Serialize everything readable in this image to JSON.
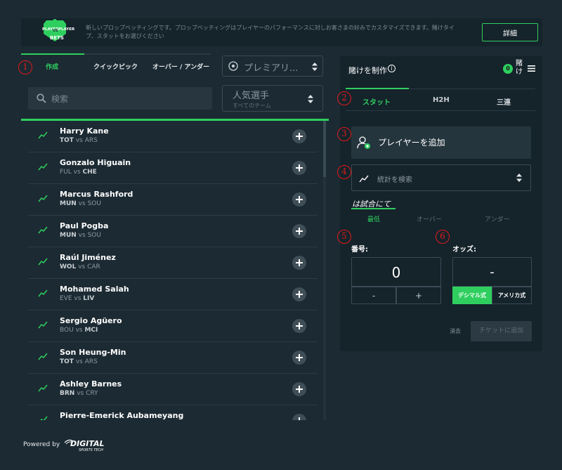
{
  "banner": {
    "description": "新しいプロップベッティングです。プロップベッティングはプレイヤーのパフォーマンスに対しお客さまの好みでカスタマイズできます。賭けタイプ、スタットをお選びください",
    "details_button": "詳細",
    "logo_text_top_left": "PLAYER",
    "logo_text_vs": "VS",
    "logo_text_top_right": "PLAYER",
    "logo_text_bottom": "BETS"
  },
  "left_tabs": [
    "作成",
    "クイックピック",
    "オーバー / アンダー"
  ],
  "league_select": {
    "value": "プレミアリ..."
  },
  "search": {
    "placeholder": "検索"
  },
  "popular_select": {
    "value": "人気選手",
    "sub": "すべてのチーム"
  },
  "players": [
    {
      "name": "Harry Kane",
      "home": "TOT",
      "away": "ARS",
      "bold": "home"
    },
    {
      "name": "Gonzalo Higuain",
      "home": "FUL",
      "away": "CHE",
      "bold": "away"
    },
    {
      "name": "Marcus Rashford",
      "home": "MUN",
      "away": "SOU",
      "bold": "home"
    },
    {
      "name": "Paul Pogba",
      "home": "MUN",
      "away": "SOU",
      "bold": "home"
    },
    {
      "name": "Raúl Jiménez",
      "home": "WOL",
      "away": "CAR",
      "bold": "home"
    },
    {
      "name": "Mohamed Salah",
      "home": "EVE",
      "away": "LIV",
      "bold": "away"
    },
    {
      "name": "Sergio Agüero",
      "home": "BOU",
      "away": "MCI",
      "bold": "away"
    },
    {
      "name": "Son Heung-Min",
      "home": "TOT",
      "away": "ARS",
      "bold": "home"
    },
    {
      "name": "Ashley Barnes",
      "home": "BRN",
      "away": "CRY",
      "bold": "home"
    },
    {
      "name": "Pierre-Emerick Aubameyang",
      "home": "",
      "away": "",
      "bold": ""
    }
  ],
  "vs_word": "vs",
  "footer": {
    "powered_by": "Powered by",
    "brand_top": "DIGITAL",
    "brand_bottom": "SPORTS TECH"
  },
  "bet_builder": {
    "title": "賭けを制作",
    "info_symbol": "i",
    "bet_count": "0",
    "bet_label": "賭け",
    "tabs": [
      "スタット",
      "H2H",
      "三連"
    ],
    "add_player": "プレイヤーを追加",
    "stat_placeholder": "統計を検索",
    "at_match": "は試合にて",
    "segments": [
      "最低",
      "オーバー",
      "アンダー"
    ],
    "number_label": "番号:",
    "number_value": "0",
    "minus": "-",
    "plus": "+",
    "odds_label": "オッズ:",
    "odds_value": "-",
    "decimal_label": "デシマル式",
    "american_label": "アメリカ式",
    "clear": "消去",
    "add_ticket": "チケットに追加"
  },
  "annotations": [
    "1",
    "2",
    "3",
    "4",
    "5",
    "6"
  ],
  "colors": {
    "accent": "#2fcf5f",
    "background": "#1c2a33",
    "panel": "#15232b",
    "annotation": "#e11a1a"
  }
}
